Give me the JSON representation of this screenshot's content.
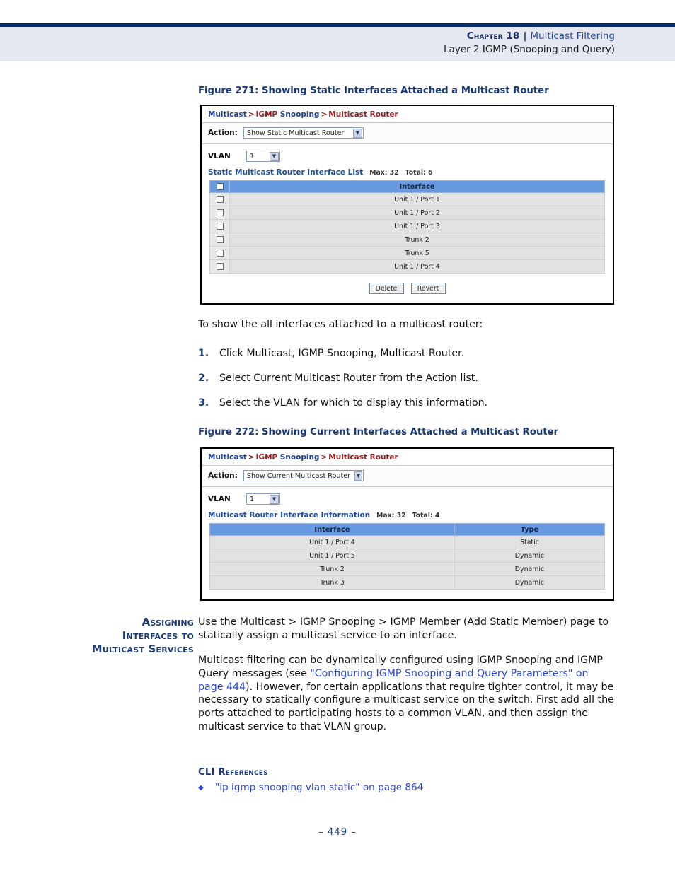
{
  "header": {
    "chapter": "Chapter 18",
    "separator": "|",
    "topic": "Multicast Filtering",
    "subtitle": "Layer 2 IGMP (Snooping and Query)"
  },
  "figure271": {
    "caption": "Figure 271:  Showing Static Interfaces Attached a Multicast Router",
    "breadcrumb": {
      "part1": "Multicast",
      "sep1": ">",
      "part2": "IGMP",
      "part3": "Snooping",
      "sep2": ">",
      "part4": "Multicast Router"
    },
    "action_label": "Action:",
    "action_value": "Show Static Multicast Router",
    "vlan_label": "VLAN",
    "vlan_value": "1",
    "list_title": "Static Multicast Router Interface List",
    "max_label": "Max: 32",
    "total_label": "Total: 6",
    "column_header": "Interface",
    "rows": [
      "Unit 1 / Port 1",
      "Unit 1 / Port 2",
      "Unit 1 / Port 3",
      "Trunk 2",
      "Trunk 5",
      "Unit 1 / Port 4"
    ],
    "delete_button": "Delete",
    "revert_button": "Revert"
  },
  "instructions": {
    "intro": "To show the all interfaces attached to a multicast router:",
    "steps": [
      {
        "num": "1.",
        "text": "Click Multicast, IGMP Snooping, Multicast Router."
      },
      {
        "num": "2.",
        "text": "Select Current Multicast Router from the Action list."
      },
      {
        "num": "3.",
        "text": "Select the VLAN for which to display this information."
      }
    ]
  },
  "figure272": {
    "caption": "Figure 272:  Showing Current Interfaces Attached a Multicast Router",
    "breadcrumb": {
      "part1": "Multicast",
      "sep1": ">",
      "part2": "IGMP",
      "part3": "Snooping",
      "sep2": ">",
      "part4": "Multicast Router"
    },
    "action_label": "Action:",
    "action_value": "Show Current Multicast Router",
    "vlan_label": "VLAN",
    "vlan_value": "1",
    "list_title": "Multicast Router Interface Information",
    "max_label": "Max: 32",
    "total_label": "Total: 4",
    "columns": [
      "Interface",
      "Type"
    ],
    "rows": [
      [
        "Unit 1 / Port 4",
        "Static"
      ],
      [
        "Unit 1 / Port 5",
        "Dynamic"
      ],
      [
        "Trunk 2",
        "Dynamic"
      ],
      [
        "Trunk 3",
        "Dynamic"
      ]
    ]
  },
  "section": {
    "side_heading_line1": "Assigning",
    "side_heading_line2": "Interfaces to",
    "side_heading_line3": "Multicast Services",
    "para1": "Use the Multicast > IGMP Snooping > IGMP Member (Add Static Member) page to statically assign a multicast service to an interface.",
    "para2_before": "Multicast filtering can be dynamically configured using IGMP Snooping and IGMP Query messages (see ",
    "para2_link": "\"Configuring IGMP Snooping and Query Parameters\" on page 444",
    "para2_after": "). However, for certain applications that require tighter control, it may be necessary to statically configure a multicast service on the switch. First add all the ports attached to participating hosts to a common VLAN, and then assign the multicast service to that VLAN group."
  },
  "cli": {
    "heading": "CLI References",
    "bullet": "◆",
    "item": "\"ip igmp snooping vlan static\" on page 864"
  },
  "footer": {
    "page": "–  449  –"
  }
}
